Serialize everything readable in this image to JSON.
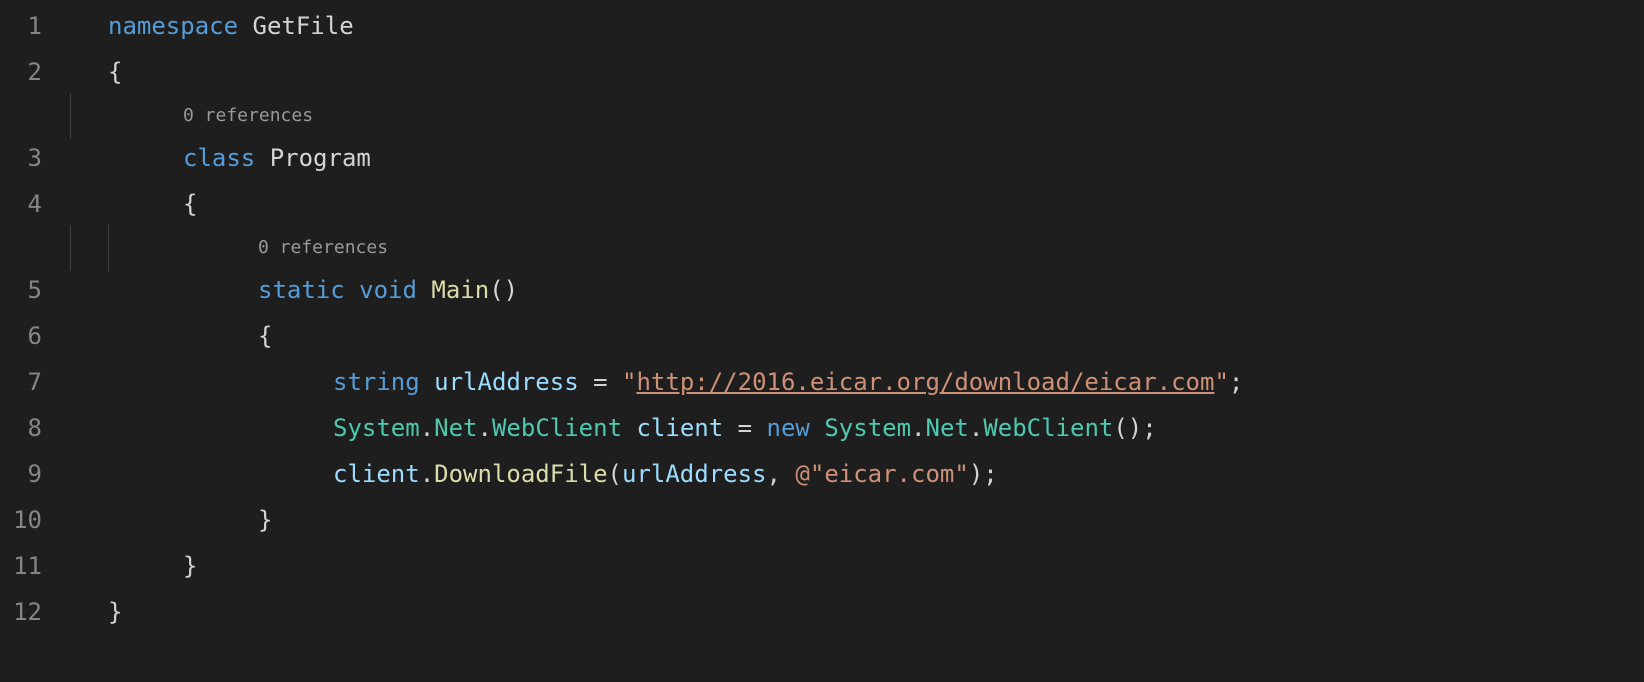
{
  "lines": {
    "l1": "1",
    "l2": "2",
    "l3": "3",
    "l4": "4",
    "l5": "5",
    "l6": "6",
    "l7": "7",
    "l8": "8",
    "l9": "9",
    "l10": "10",
    "l11": "11",
    "l12": "12"
  },
  "codelens": {
    "class": "0 references",
    "main": "0 references"
  },
  "code": {
    "namespace_kw": "namespace",
    "namespace_name": " GetFile",
    "brace_open": "{",
    "brace_close": "}",
    "class_kw": "class",
    "class_name": " Program",
    "static_kw": "static",
    "void_kw": " void",
    "main_name": " Main",
    "main_parens": "()",
    "string_kw": "string",
    "urlAddress_var": " urlAddress",
    "eq": " = ",
    "quote": "\"",
    "url_value": "http://2016.eicar.org/download/eicar.com",
    "semicolon": ";",
    "system": "System",
    "dot": ".",
    "net": "Net",
    "webclient": "WebClient",
    "client_var": " client",
    "new_kw": "new",
    "space": " ",
    "parens_empty": "()",
    "client_ref": "client",
    "downloadfile": "DownloadFile",
    "lparen": "(",
    "rparen": ")",
    "urlAddress_ref": "urlAddress",
    "comma": ", ",
    "at": "@",
    "eicar_str": "eicar.com"
  }
}
